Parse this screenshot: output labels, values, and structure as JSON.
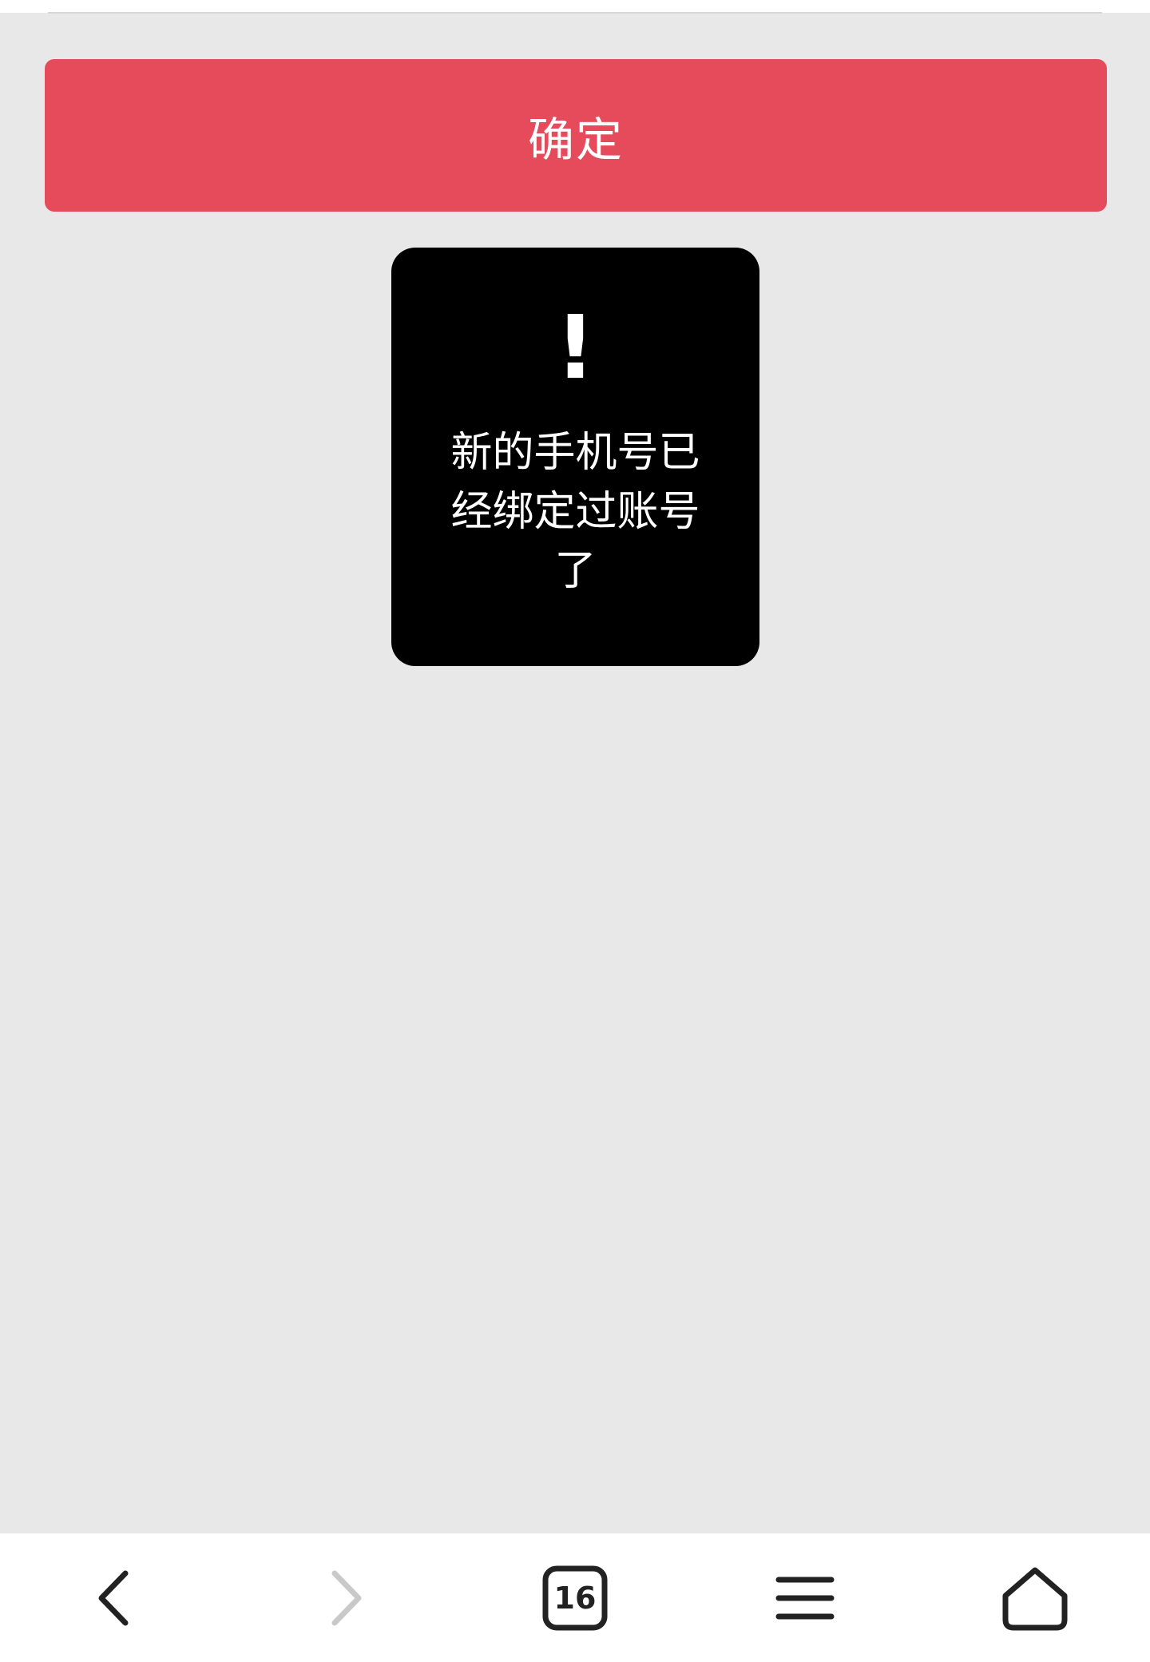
{
  "confirm_button": {
    "label": "确定",
    "color": "#e64b5c"
  },
  "toast": {
    "icon": "!",
    "message": "新的手机号已经绑定过账号了"
  },
  "bottom_nav": {
    "back_icon": "chevron-left-icon",
    "forward_icon": "chevron-right-icon",
    "tabs_icon": "tabs-icon",
    "tabs_count": "16",
    "menu_icon": "menu-icon",
    "home_icon": "home-icon"
  }
}
